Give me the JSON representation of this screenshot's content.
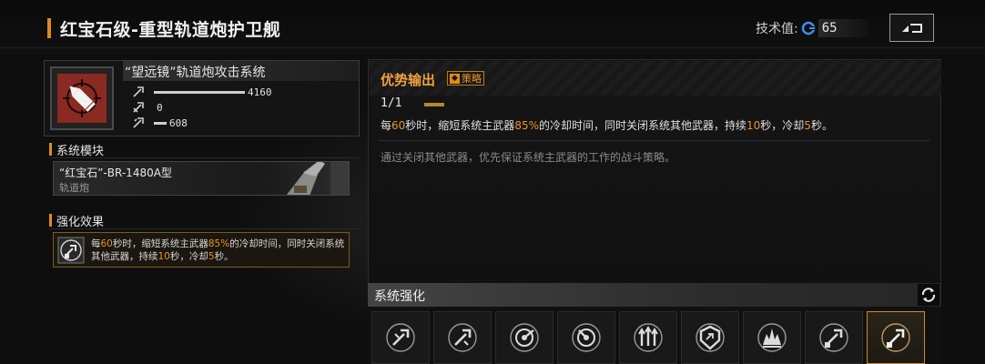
{
  "header": {
    "title": "红宝石级-重型轨道炮护卫舰",
    "tech_label": "技术值:",
    "tech_value": "65"
  },
  "weapon": {
    "name": "“望远镜”轨道炮攻击系统",
    "stats": [
      {
        "icon": "damage-stat-icon",
        "value": "4160"
      },
      {
        "icon": "speed-stat-icon",
        "value": "0"
      },
      {
        "icon": "range-stat-icon",
        "value": "608"
      }
    ]
  },
  "module_section": {
    "title": "系统模块",
    "module_name": "“红宝石”-BR-1480A型",
    "module_type": "轨道炮"
  },
  "effect_section": {
    "title": "强化效果",
    "text_parts": [
      "每",
      "60",
      "秒时，缩短系统主武器",
      "85%",
      "的冷却时间，同时关闭系统其他武器，持续",
      "10",
      "秒，冷却",
      "5",
      "秒。"
    ]
  },
  "skill": {
    "title": "优势输出",
    "badge": "策略",
    "level": "1/1",
    "desc_parts": [
      "每",
      "60",
      "秒时，缩短系统主武器",
      "85%",
      "的冷却时间，同时关闭系统其他武器，持续",
      "10",
      "秒，冷却",
      "5",
      "秒。"
    ],
    "flavor": "通过关闭其他武器，优先保证系统主武器的工作的战斗策略。"
  },
  "upgrade": {
    "title": "系统强化",
    "slots": [
      {
        "icon": "missile-wrench-icon",
        "active": false
      },
      {
        "icon": "missile-wrench-icon",
        "active": false
      },
      {
        "icon": "radar-sweep-icon",
        "active": false
      },
      {
        "icon": "radar-sweep-icon",
        "active": false
      },
      {
        "icon": "triple-arrow-icon",
        "active": false
      },
      {
        "icon": "shield-badge-icon",
        "active": false
      },
      {
        "icon": "explosion-icon",
        "active": false
      },
      {
        "icon": "railgun-strategy-icon",
        "active": false
      },
      {
        "icon": "railgun-strategy-icon",
        "active": true
      }
    ]
  },
  "colors": {
    "accent": "#e08a1e",
    "highlight": "#e8932a",
    "weapon_icon_bg": "#8a2a22"
  }
}
